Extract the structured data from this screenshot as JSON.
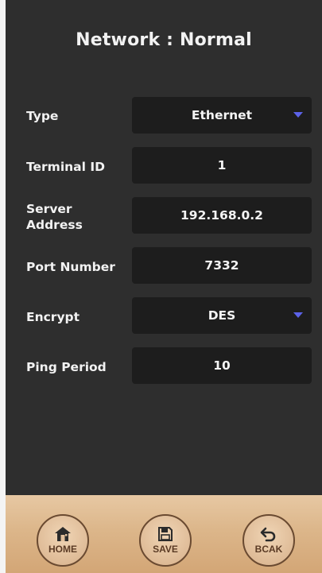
{
  "title": "Network : Normal",
  "rows": [
    {
      "label": "Type",
      "value": "Ethernet",
      "dropdown": true
    },
    {
      "label": "Terminal ID",
      "value": "1",
      "dropdown": false
    },
    {
      "label": "Server\nAddress",
      "value": "192.168.0.2",
      "dropdown": false
    },
    {
      "label": "Port Number",
      "value": "7332",
      "dropdown": false
    },
    {
      "label": "Encrypt",
      "value": "DES",
      "dropdown": true
    },
    {
      "label": "Ping Period",
      "value": "10",
      "dropdown": false
    }
  ],
  "buttons": {
    "home": {
      "label": "HOME",
      "icon": "home-icon"
    },
    "save": {
      "label": "SAVE",
      "icon": "save-icon"
    },
    "back": {
      "label": "BCAK",
      "icon": "back-arrow-icon"
    }
  },
  "colors": {
    "screen_bg": "#2e2e2e",
    "field_bg": "#1d1d1d",
    "dropdown_caret": "#5b62e8",
    "bottom_bar": "#dcb68a"
  }
}
